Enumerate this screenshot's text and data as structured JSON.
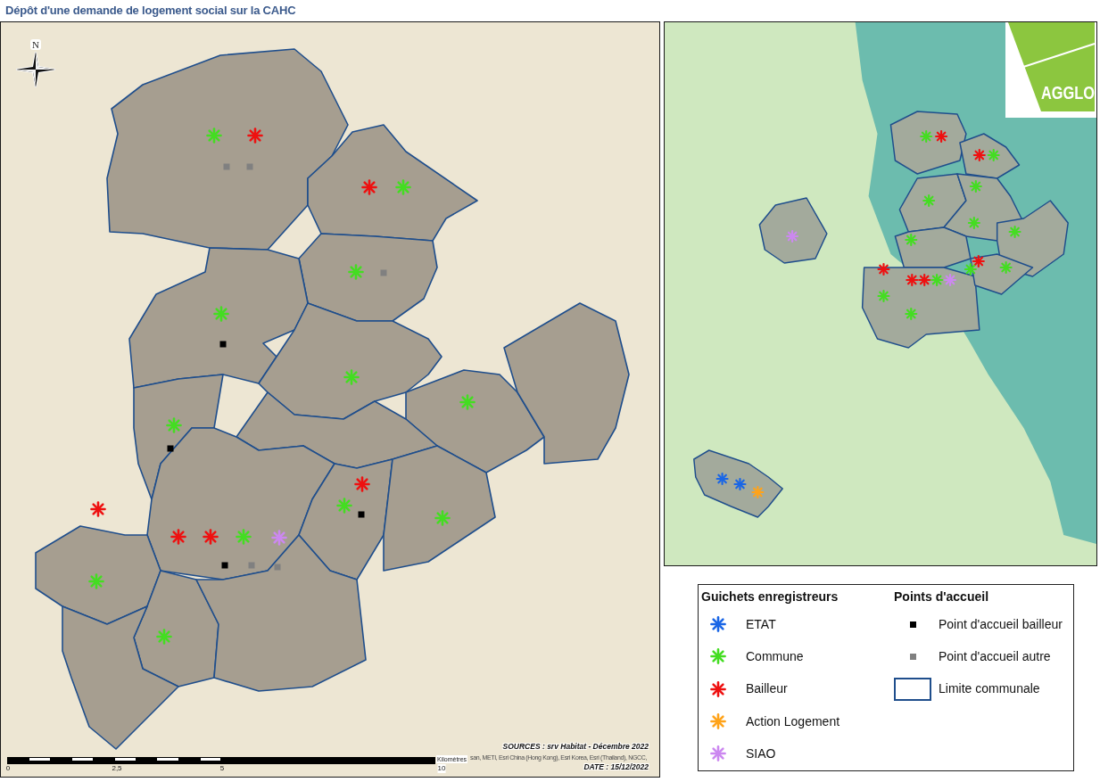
{
  "title": "Dépôt d'une demande de logement social sur la CAHC",
  "left_map": {
    "north_arrow": {
      "label": "N"
    },
    "markers": [
      {
        "kind": "asterisk",
        "color": "#44dd22"
      },
      {
        "kind": "asterisk",
        "color": "#ee1111"
      },
      {
        "kind": "square",
        "color": "#808080"
      },
      {
        "kind": "square",
        "color": "#808080"
      },
      {
        "kind": "asterisk",
        "color": "#ee1111"
      },
      {
        "kind": "asterisk",
        "color": "#44dd22"
      },
      {
        "kind": "asterisk",
        "color": "#44dd22"
      },
      {
        "kind": "square",
        "color": "#808080"
      },
      {
        "kind": "asterisk",
        "color": "#44dd22"
      },
      {
        "kind": "square",
        "color": "#000000"
      },
      {
        "kind": "asterisk",
        "color": "#44dd22"
      },
      {
        "kind": "asterisk",
        "color": "#44dd22"
      },
      {
        "kind": "asterisk",
        "color": "#44dd22"
      },
      {
        "kind": "square",
        "color": "#000000"
      },
      {
        "kind": "asterisk",
        "color": "#ee1111"
      },
      {
        "kind": "asterisk",
        "color": "#44dd22"
      },
      {
        "kind": "asterisk",
        "color": "#ee1111"
      },
      {
        "kind": "square",
        "color": "#000000"
      },
      {
        "kind": "asterisk",
        "color": "#44dd22"
      },
      {
        "kind": "asterisk",
        "color": "#ee1111"
      },
      {
        "kind": "asterisk",
        "color": "#ee1111"
      },
      {
        "kind": "asterisk",
        "color": "#44dd22"
      },
      {
        "kind": "asterisk",
        "color": "#cc88f0"
      },
      {
        "kind": "square",
        "color": "#000000"
      },
      {
        "kind": "square",
        "color": "#808080"
      },
      {
        "kind": "square",
        "color": "#808080"
      },
      {
        "kind": "asterisk",
        "color": "#44dd22"
      },
      {
        "kind": "asterisk",
        "color": "#44dd22"
      }
    ],
    "scale_bar": {
      "labels": [
        "0",
        "2,5",
        "5",
        "10"
      ],
      "unit": "Kilomètres"
    },
    "sources": "SOURCES : srv Habitat - Décembre 2022",
    "attribution": "san, METI, Esri China (Hong Kong), Esri Korea, Esri (Thailand), NGCC,",
    "date": "DATE : 15/12/2022"
  },
  "right_map": {
    "logo": {
      "text": "AGGLO"
    },
    "markers": [
      {
        "kind": "asterisk",
        "color": "#44dd22"
      },
      {
        "kind": "asterisk",
        "color": "#ee1111"
      },
      {
        "kind": "asterisk",
        "color": "#ee1111"
      },
      {
        "kind": "asterisk",
        "color": "#44dd22"
      },
      {
        "kind": "asterisk",
        "color": "#44dd22"
      },
      {
        "kind": "asterisk",
        "color": "#44dd22"
      },
      {
        "kind": "asterisk",
        "color": "#44dd22"
      },
      {
        "kind": "asterisk",
        "color": "#44dd22"
      },
      {
        "kind": "asterisk",
        "color": "#cc88f0"
      },
      {
        "kind": "asterisk",
        "color": "#44dd22"
      },
      {
        "kind": "asterisk",
        "color": "#ee1111"
      },
      {
        "kind": "asterisk",
        "color": "#44dd22"
      },
      {
        "kind": "asterisk",
        "color": "#ee1111"
      },
      {
        "kind": "asterisk",
        "color": "#44dd22"
      },
      {
        "kind": "asterisk",
        "color": "#ee1111"
      },
      {
        "kind": "asterisk",
        "color": "#ee1111"
      },
      {
        "kind": "asterisk",
        "color": "#44dd22"
      },
      {
        "kind": "asterisk",
        "color": "#cc88f0"
      },
      {
        "kind": "asterisk",
        "color": "#44dd22"
      },
      {
        "kind": "asterisk",
        "color": "#44dd22"
      },
      {
        "kind": "asterisk",
        "color": "#1a66e6"
      },
      {
        "kind": "asterisk",
        "color": "#1a66e6"
      },
      {
        "kind": "asterisk",
        "color": "#ffa31a"
      }
    ]
  },
  "legend": {
    "groups": [
      {
        "title": "Guichets enregistreurs",
        "items": [
          {
            "kind": "asterisk",
            "color": "#1a66e6",
            "label": "ETAT"
          },
          {
            "kind": "asterisk",
            "color": "#44dd22",
            "label": "Commune"
          },
          {
            "kind": "asterisk",
            "color": "#ee1111",
            "label": "Bailleur"
          },
          {
            "kind": "asterisk",
            "color": "#ffa31a",
            "label": "Action Logement"
          },
          {
            "kind": "asterisk",
            "color": "#cc88f0",
            "label": "SIAO"
          }
        ]
      },
      {
        "title": "Points d'accueil",
        "items": [
          {
            "kind": "square",
            "color": "#000000",
            "label": "Point d'accueil bailleur"
          },
          {
            "kind": "square",
            "color": "#808080",
            "label": "Point d'accueil autre"
          },
          {
            "kind": "outline",
            "color": "#1f4e8c",
            "label": "Limite communale"
          }
        ]
      }
    ]
  }
}
